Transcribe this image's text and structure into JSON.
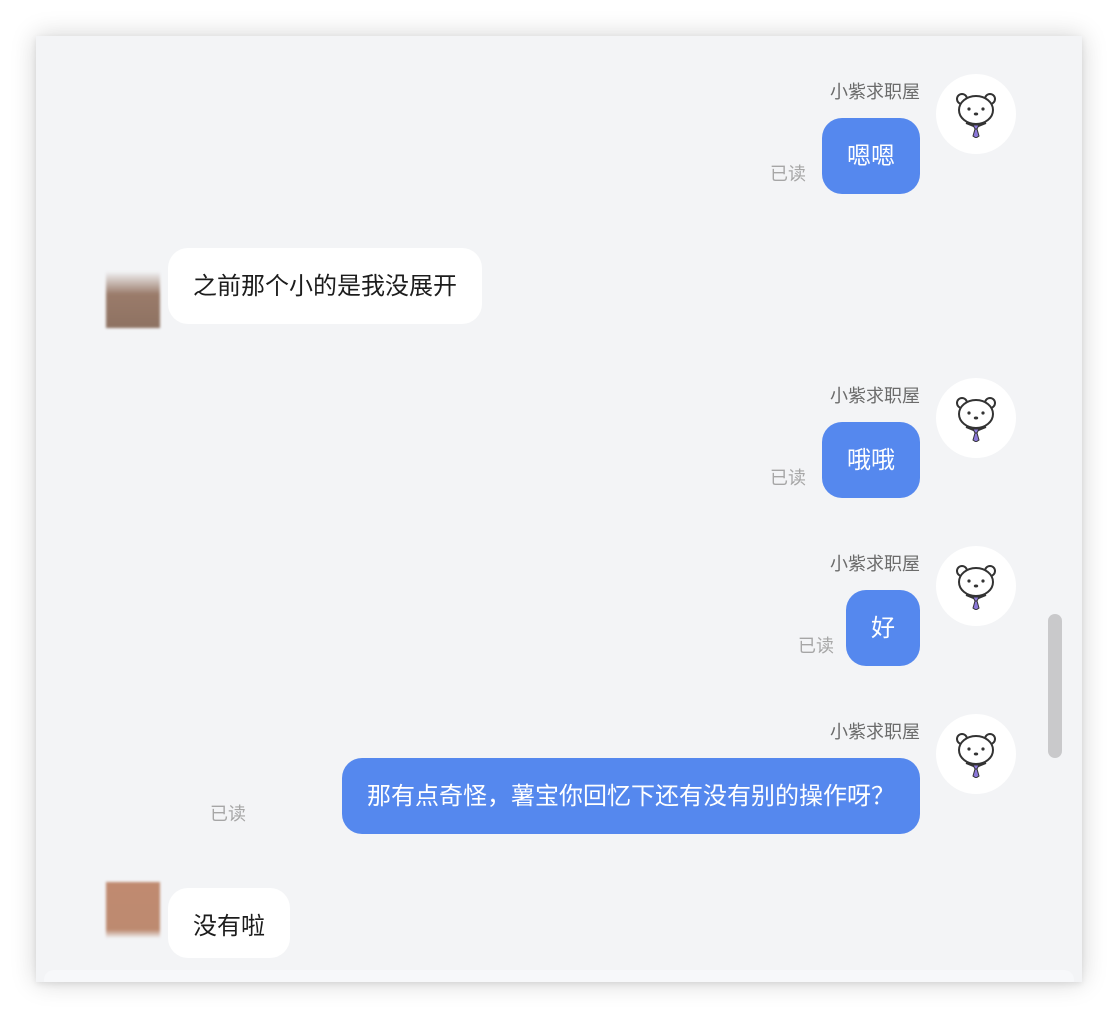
{
  "self": {
    "name": "小紫求职屋",
    "avatar_icon": "bear-with-tie-icon"
  },
  "other": {
    "avatar_icon": "blurred-user-avatar"
  },
  "messages": [
    {
      "from": "self",
      "sender": "小紫求职屋",
      "text": "嗯嗯",
      "status": "已读"
    },
    {
      "from": "other",
      "text": "之前那个小的是我没展开"
    },
    {
      "from": "self",
      "sender": "小紫求职屋",
      "text": "哦哦",
      "status": "已读"
    },
    {
      "from": "self",
      "sender": "小紫求职屋",
      "text": "好",
      "status": "已读"
    },
    {
      "from": "self",
      "sender": "小紫求职屋",
      "text": "那有点奇怪，薯宝你回忆下还有没有别的操作呀？",
      "status": "已读"
    },
    {
      "from": "other",
      "text": "没有啦"
    }
  ],
  "colors": {
    "outgoing_bubble": "#5588ee",
    "incoming_bubble": "#ffffff",
    "background": "#f3f4f6",
    "read_status": "#a6a6a6",
    "avatar_blur_1": "#9a7b6a",
    "avatar_blur_2": "#c08a70"
  }
}
